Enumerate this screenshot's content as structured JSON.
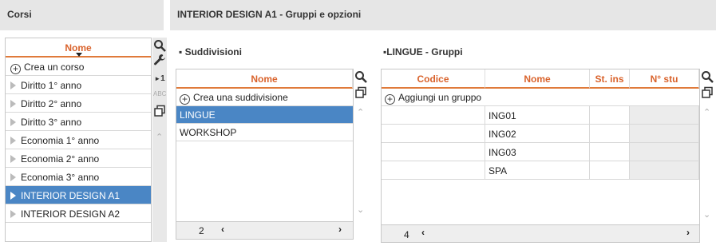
{
  "left": {
    "title": "Corsi",
    "column": "Nome",
    "add_label": "Crea un corso",
    "items": [
      {
        "label": "Diritto 1° anno",
        "selected": false
      },
      {
        "label": "Diritto 2° anno",
        "selected": false
      },
      {
        "label": "Diritto 3° anno",
        "selected": false
      },
      {
        "label": "Economia 1° anno",
        "selected": false
      },
      {
        "label": "Economia 2° anno",
        "selected": false
      },
      {
        "label": "Economia 3° anno",
        "selected": false
      },
      {
        "label": "INTERIOR DESIGN A1",
        "selected": true
      },
      {
        "label": "INTERIOR DESIGN A2",
        "selected": false
      }
    ],
    "tools": {
      "number_label": "1",
      "abc_label": "ABC"
    }
  },
  "right": {
    "title": "INTERIOR DESIGN A1 - Gruppi e opzioni",
    "suddivisioni": {
      "title": "Suddivisioni",
      "column": "Nome",
      "add_label": "Crea una suddivisione",
      "items": [
        {
          "label": "LINGUE",
          "selected": true
        },
        {
          "label": "WORKSHOP",
          "selected": false
        }
      ],
      "count": "2"
    },
    "gruppi": {
      "title": "LINGUE - Gruppi",
      "columns": [
        "Codice",
        "Nome",
        "St. ins",
        "N° stu"
      ],
      "add_label": "Aggiungi un gruppo",
      "rows": [
        {
          "codice": "",
          "nome": "ING01",
          "st_ins": "",
          "n_stu": ""
        },
        {
          "codice": "",
          "nome": "ING02",
          "st_ins": "",
          "n_stu": ""
        },
        {
          "codice": "",
          "nome": "ING03",
          "st_ins": "",
          "n_stu": ""
        },
        {
          "codice": "",
          "nome": "SPA",
          "st_ins": "",
          "n_stu": ""
        }
      ],
      "count": "4"
    }
  },
  "colors": {
    "accent": "#d9622b",
    "selection": "#4a86c5",
    "header_bg": "#e6e6e6"
  }
}
